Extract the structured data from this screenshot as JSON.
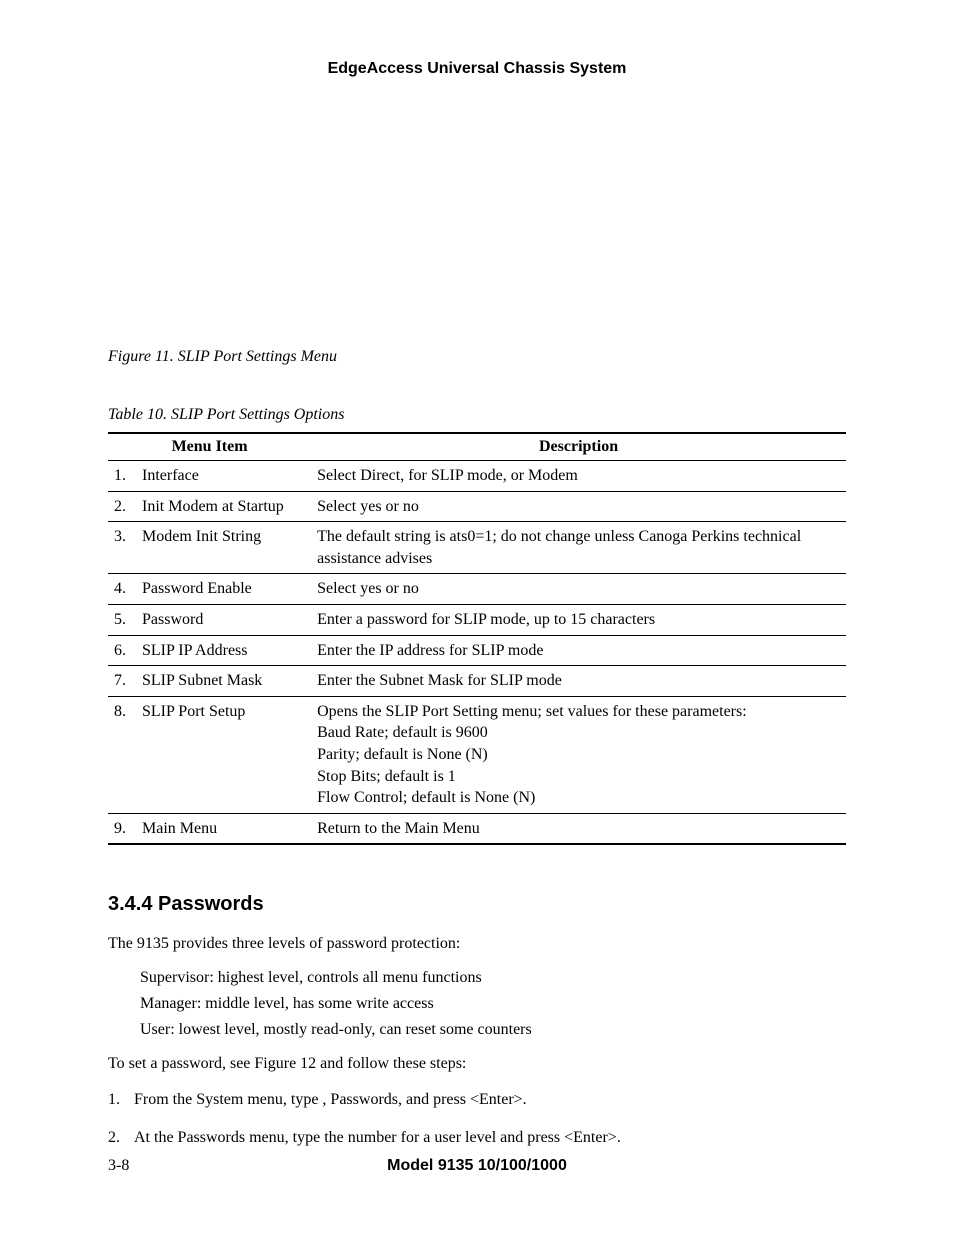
{
  "header": "EdgeAccess Universal Chassis System",
  "figure_caption": "Figure 11.  SLIP Port Settings Menu",
  "table_caption": "Table 10.  SLIP Port Settings Options",
  "table": {
    "columns": [
      "Menu Item",
      "Description"
    ],
    "rows": [
      {
        "num": "1.",
        "item": "Interface",
        "desc": [
          "Select Direct, for SLIP mode, or Modem"
        ]
      },
      {
        "num": "2.",
        "item": "Init Modem at Startup",
        "desc": [
          "Select yes or no"
        ]
      },
      {
        "num": "3.",
        "item": "Modem Init String",
        "desc": [
          "The default string is ats0=1; do not change unless Canoga Perkins technical assistance advises"
        ]
      },
      {
        "num": "4.",
        "item": "Password Enable",
        "desc": [
          "Select yes or no"
        ]
      },
      {
        "num": "5.",
        "item": "Password",
        "desc": [
          "Enter a password for SLIP mode, up to 15 characters"
        ]
      },
      {
        "num": "6.",
        "item": "SLIP IP Address",
        "desc": [
          "Enter the IP address for SLIP mode"
        ]
      },
      {
        "num": "7.",
        "item": "SLIP Subnet Mask",
        "desc": [
          "Enter the Subnet Mask for SLIP mode"
        ]
      },
      {
        "num": "8.",
        "item": "SLIP Port Setup",
        "desc": [
          "Opens the SLIP Port Setting menu; set values for these parameters:",
          "Baud Rate;  default is 9600",
          "Parity;  default is None (N)",
          "Stop Bits;  default is 1",
          "Flow Control;  default is None (N)"
        ]
      },
      {
        "num": "9.",
        "item": "Main Menu",
        "desc": [
          "Return to the Main Menu"
        ]
      }
    ]
  },
  "section": {
    "heading": "3.4.4  Passwords",
    "intro": "The 9135 provides three levels of password protection:",
    "levels": [
      "Supervisor:  highest level, controls all menu functions",
      "Manager:  middle level, has some write access",
      "User:  lowest level, mostly read-only, can reset some counters"
    ],
    "steps_intro": "To set a password, see Figure 12 and follow these steps:",
    "steps": [
      {
        "n": "1.",
        "text": "From the System menu, type   , Passwords, and press <Enter>."
      },
      {
        "n": "2.",
        "text": "At the Passwords menu, type the number for a user level and press <Enter>."
      }
    ]
  },
  "footer": {
    "page": "3-8",
    "model": "Model 9135 10/100/1000"
  }
}
